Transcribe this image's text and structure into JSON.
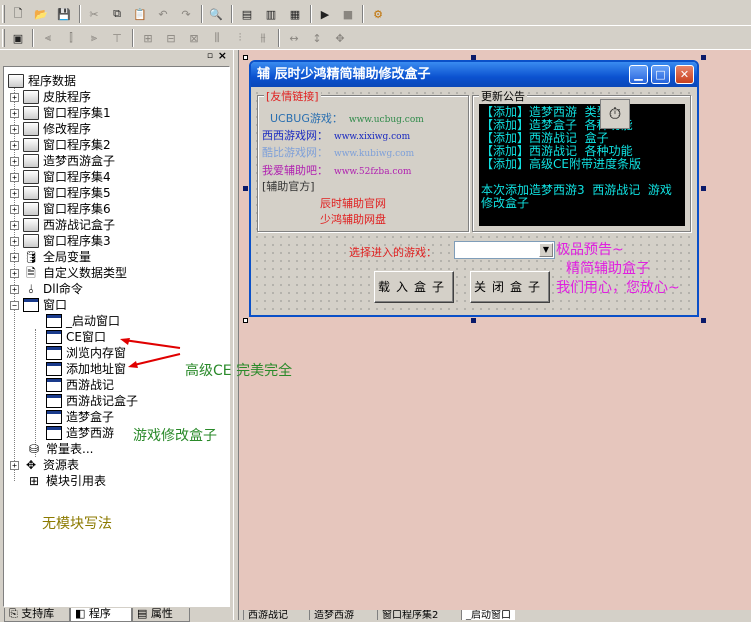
{
  "toolbar1": {
    "icons": [
      "new-icon",
      "open-icon",
      "save-icon",
      "cut-icon",
      "copy-icon",
      "paste-icon",
      "undo-icon",
      "redo-icon",
      "find-icon",
      "layout1-icon",
      "layout2-icon",
      "layout3-icon",
      "run-icon",
      "stop-icon",
      "compile-icon"
    ]
  },
  "tree": {
    "root": "程序数据",
    "items": [
      {
        "label": "皮肤程序",
        "icon": "book"
      },
      {
        "label": "窗口程序集1",
        "icon": "book"
      },
      {
        "label": "修改程序",
        "icon": "book"
      },
      {
        "label": "窗口程序集2",
        "icon": "book"
      },
      {
        "label": "造梦西游盒子",
        "icon": "book"
      },
      {
        "label": "窗口程序集4",
        "icon": "book"
      },
      {
        "label": "窗口程序集5",
        "icon": "book"
      },
      {
        "label": "窗口程序集6",
        "icon": "book"
      },
      {
        "label": "西游战记盒子",
        "icon": "book"
      },
      {
        "label": "窗口程序集3",
        "icon": "book"
      },
      {
        "label": "全局变量",
        "icon": "var"
      },
      {
        "label": "自定义数据类型",
        "icon": "type"
      },
      {
        "label": "Dll命令",
        "icon": "dll"
      },
      {
        "label": "窗口",
        "icon": "win"
      }
    ],
    "windows": [
      "_启动窗口",
      "CE窗口",
      "浏览内存窗",
      "添加地址窗",
      "西游战记",
      "西游战记盒子",
      "造梦盒子",
      "造梦西游"
    ],
    "tail": [
      {
        "label": "常量表...",
        "icon": "const"
      },
      {
        "label": "资源表",
        "icon": "res"
      },
      {
        "label": "模块引用表",
        "icon": "mod"
      }
    ]
  },
  "bottom_tabs": [
    "支持库",
    "程序",
    "属性"
  ],
  "doc_tabs": [
    "西游战记",
    "造梦西游",
    "窗口程序集2",
    "_启动窗口"
  ],
  "form": {
    "title": "辅 辰时少鸿精简辅助修改盒子",
    "links_group": "[友情链接]",
    "links": [
      {
        "name": "UCBUG游戏：",
        "url": "www.ucbug.com",
        "color": "#2a6fb0"
      },
      {
        "name": "西西游戏网：",
        "url": "www.xixiwg.com",
        "color": "#1a2ac0"
      },
      {
        "name": "酷比游戏网：",
        "url": "www.kubiwg.com",
        "color": "#7fa0d8"
      },
      {
        "name": "我爱辅助吧：",
        "url": "www.52fzba.com",
        "color": "#b020b0"
      }
    ],
    "official_group": "[辅助官方]",
    "official": [
      "辰时辅助官网",
      "少鸿辅助网盘"
    ],
    "notice_group": "更新公告",
    "notice_text": "【添加】造梦西游  类型\n【添加】造梦盒子  各种功能\n【添加】西游战记  盒子\n【添加】西游战记  各种功能\n【添加】高级CE附带进度条版\n\n本次添加造梦西游3  西游战记  游戏修改盒子",
    "select_label": "选择进入的游戏：",
    "load_button": "载入盒子",
    "close_button": "关闭盒子"
  },
  "promo": [
    "极品预告~",
    "精简辅助盒子",
    "我们用心，您放心~"
  ],
  "annotations": {
    "ce": "高级CE 完美完全",
    "box": "游戏修改盒子",
    "nomod": "无模块写法"
  }
}
